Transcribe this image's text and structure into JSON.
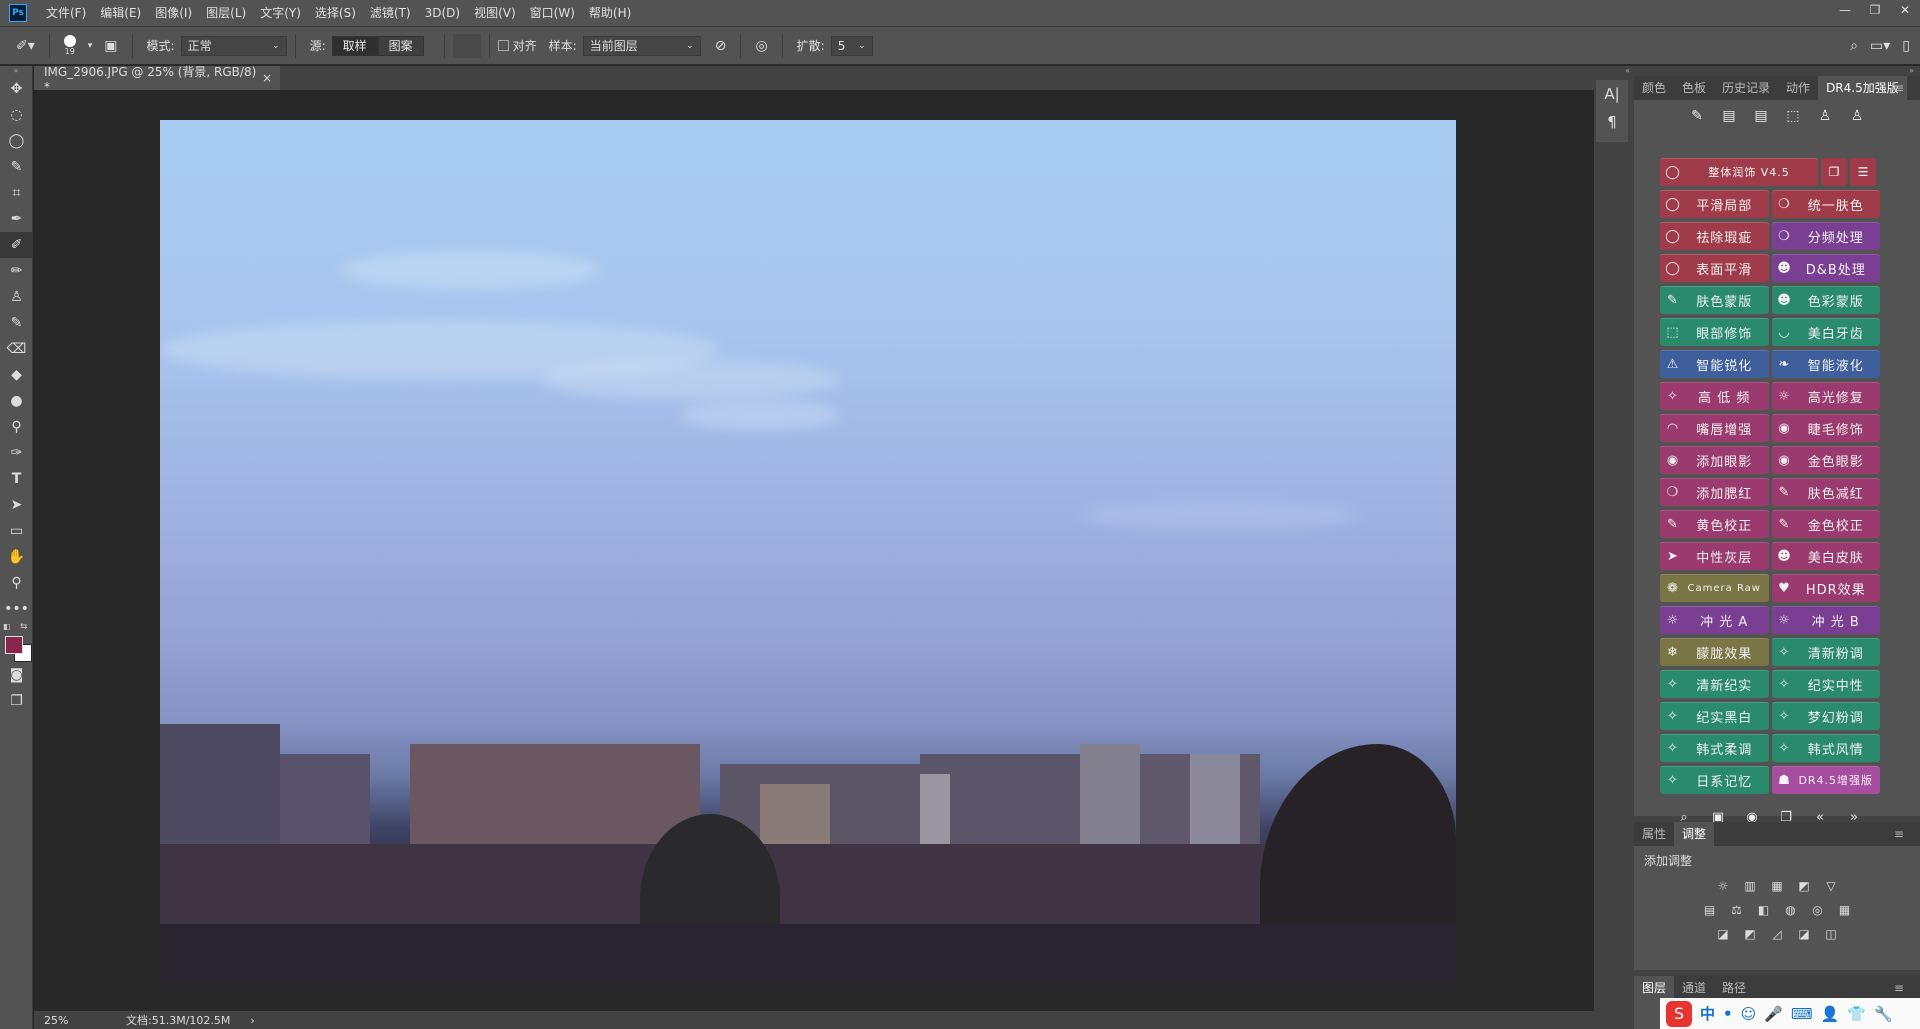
{
  "menu": [
    "文件(F)",
    "编辑(E)",
    "图像(I)",
    "图层(L)",
    "文字(Y)",
    "选择(S)",
    "滤镜(T)",
    "3D(D)",
    "视图(V)",
    "窗口(W)",
    "帮助(H)"
  ],
  "app_logo": "Ps",
  "window_controls": [
    "—",
    "❐",
    "✕"
  ],
  "options": {
    "brush_size": "19",
    "mode_label": "模式:",
    "mode_value": "正常",
    "source_label": "源:",
    "source_sample": "取样",
    "source_pattern": "图案",
    "align_label": "对齐",
    "sample_label": "样本:",
    "sample_value": "当前图层",
    "diffusion_label": "扩散:",
    "diffusion_value": "5"
  },
  "document_tab": {
    "title": "IMG_2906.JPG @ 25% (背景, RGB/8) *",
    "close": "×"
  },
  "status": {
    "zoom": "25%",
    "doc_info": "文档:51.3M/102.5M",
    "arrow": "›"
  },
  "strip_icons": [
    "A|",
    "¶"
  ],
  "top_panel": {
    "tabs": [
      "颜色",
      "色板",
      "历史记录",
      "动作",
      "DR4.5加强版"
    ],
    "active_tab": "DR4.5加强版",
    "menu_icon": "≡"
  },
  "dr_buttons": [
    [
      {
        "label": "整体润饰  V4.5",
        "color": "red",
        "icon": "◯",
        "wide": true
      }
    ],
    [
      {
        "label": "平滑局部",
        "color": "red",
        "icon": "◯"
      },
      {
        "label": "统一肤色",
        "color": "red",
        "icon": "❍"
      }
    ],
    [
      {
        "label": "祛除瑕疵",
        "color": "red",
        "icon": "◯"
      },
      {
        "label": "分频处理",
        "color": "purple",
        "icon": "❍"
      }
    ],
    [
      {
        "label": "表面平滑",
        "color": "red",
        "icon": "◯"
      },
      {
        "label": "D&B处理",
        "color": "purple",
        "icon": "☻"
      }
    ],
    [
      {
        "label": "肤色蒙版",
        "color": "green",
        "icon": "✎"
      },
      {
        "label": "色彩蒙版",
        "color": "green",
        "icon": "☻"
      }
    ],
    [
      {
        "label": "眼部修饰",
        "color": "green",
        "icon": "⬚"
      },
      {
        "label": "美白牙齿",
        "color": "green",
        "icon": "◡"
      }
    ],
    [
      {
        "label": "智能锐化",
        "color": "blue",
        "icon": "⚠"
      },
      {
        "label": "智能液化",
        "color": "blue",
        "icon": "❧"
      }
    ],
    [
      {
        "label": "高 低 频",
        "color": "magenta",
        "icon": "✧"
      },
      {
        "label": "高光修复",
        "color": "magenta",
        "icon": "☼"
      }
    ],
    [
      {
        "label": "嘴唇增强",
        "color": "magenta",
        "icon": "◠"
      },
      {
        "label": "睫毛修饰",
        "color": "magenta",
        "icon": "◉"
      }
    ],
    [
      {
        "label": "添加眼影",
        "color": "magenta",
        "icon": "◉"
      },
      {
        "label": "金色眼影",
        "color": "magenta",
        "icon": "◉"
      }
    ],
    [
      {
        "label": "添加腮红",
        "color": "magenta",
        "icon": "❍"
      },
      {
        "label": "肤色减红",
        "color": "magenta",
        "icon": "✎"
      }
    ],
    [
      {
        "label": "黄色校正",
        "color": "magenta",
        "icon": "✎"
      },
      {
        "label": "金色校正",
        "color": "magenta",
        "icon": "✎"
      }
    ],
    [
      {
        "label": "中性灰层",
        "color": "magenta",
        "icon": "➤"
      },
      {
        "label": "美白皮肤",
        "color": "magenta",
        "icon": "☻"
      }
    ],
    [
      {
        "label": "Camera Raw",
        "color": "olive",
        "icon": "❁"
      },
      {
        "label": "HDR效果",
        "color": "magenta",
        "icon": "♥"
      }
    ],
    [
      {
        "label": "冲 光 A",
        "color": "purple",
        "icon": "☼"
      },
      {
        "label": "冲 光 B",
        "color": "purple",
        "icon": "☼"
      }
    ],
    [
      {
        "label": "朦胧效果",
        "color": "olive",
        "icon": "❄"
      },
      {
        "label": "清新粉调",
        "color": "green",
        "icon": "✧"
      }
    ],
    [
      {
        "label": "清新纪实",
        "color": "green",
        "icon": "✧"
      },
      {
        "label": "纪实中性",
        "color": "green",
        "icon": "✧"
      }
    ],
    [
      {
        "label": "纪实黑白",
        "color": "green",
        "icon": "✧"
      },
      {
        "label": "梦幻粉调",
        "color": "green",
        "icon": "✧"
      }
    ],
    [
      {
        "label": "韩式柔调",
        "color": "green",
        "icon": "✧"
      },
      {
        "label": "韩式风情",
        "color": "green",
        "icon": "✧"
      }
    ],
    [
      {
        "label": "日系记忆",
        "color": "green",
        "icon": "✧"
      },
      {
        "label": "DR4.5增强版",
        "color": "pink",
        "icon": "☗"
      }
    ]
  ],
  "dr_top_icons": [
    "✎",
    "▤",
    "▤",
    "⬚",
    "♙",
    "♙"
  ],
  "dr_bottom_icons": [
    "⌕",
    "▣",
    "◉",
    "❐",
    "«",
    "»"
  ],
  "adj_panel": {
    "tabs": [
      "属性",
      "调整"
    ],
    "active_tab": "调整",
    "title": "添加调整",
    "row1": [
      "☼",
      "▥",
      "▦",
      "◩",
      "▽"
    ],
    "row2": [
      "▤",
      "⚖",
      "◧",
      "◍",
      "◎",
      "▦"
    ],
    "row3": [
      "◪",
      "◩",
      "◿",
      "◪",
      "◫"
    ]
  },
  "layers_panel": {
    "tabs": [
      "图层",
      "通道",
      "路径"
    ],
    "active_tab": "图层"
  },
  "ime": {
    "logo": "S",
    "items": [
      "中",
      "•",
      "☺",
      "🎤",
      "⌨",
      "👤",
      "👕",
      "🔧"
    ]
  },
  "colors": {
    "foreground": "#8a2550",
    "background": "#ffffff"
  }
}
